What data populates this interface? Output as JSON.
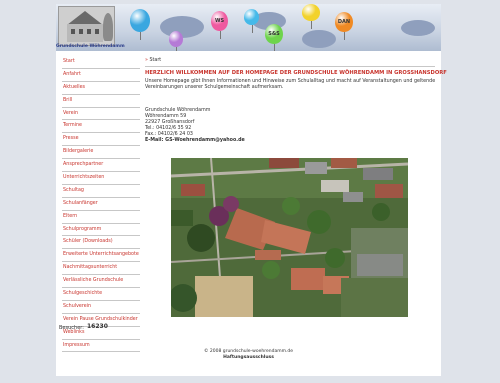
{
  "header": {
    "school_caption": "Grundschule Wöhrendamm",
    "balloons": [
      {
        "label": "",
        "color": "#3aa7e0"
      },
      {
        "label": "",
        "color": "#b57ad6"
      },
      {
        "label": "WS",
        "color": "#ef5aa0"
      },
      {
        "label": "",
        "color": "#45b9e9"
      },
      {
        "label": "S&S",
        "color": "#6ed44c"
      },
      {
        "label": "",
        "color": "#f2d22c"
      },
      {
        "label": "DAN",
        "color": "#f08a24"
      }
    ]
  },
  "nav": {
    "items": [
      {
        "label": "Start"
      },
      {
        "label": "Anfahrt"
      },
      {
        "label": "Aktuelles"
      },
      {
        "label": "Brill"
      },
      {
        "label": "Verein"
      },
      {
        "label": "Termine"
      },
      {
        "label": "Presse"
      },
      {
        "label": "Bildergalerie"
      },
      {
        "label": "Ansprechpartner"
      },
      {
        "label": "Unterrichtszeiten"
      },
      {
        "label": "Schultag"
      },
      {
        "label": "Schulanfänger"
      },
      {
        "label": "Eltern"
      },
      {
        "label": "Schulprogramm"
      },
      {
        "label": "Schüler (Downloads)"
      },
      {
        "label": "Erweiterte Unterrichtsangebote"
      },
      {
        "label": "Nachmittagsunterricht"
      },
      {
        "label": "Verlässliche Grundschule"
      },
      {
        "label": "Schulgeschichte"
      },
      {
        "label": "Schulverein"
      },
      {
        "label": "Verein Pause Grundschulkinder"
      },
      {
        "label": "Weblinks"
      },
      {
        "label": "Impressum"
      }
    ],
    "visitors_label": "Besucher:",
    "visitors_count": "16230"
  },
  "breadcrumb": {
    "separator": "»",
    "current": "Start"
  },
  "main": {
    "title": "HERZLICH WILLKOMMEN AUF DER HOMEPAGE DER GRUNDSCHULE WÖHRENDAMM IN GROSSHANSDORF",
    "intro": "Unsere Homepage gibt Ihnen Informationen und Hinweise zum Schulalltag und macht auf Veranstaltungen und geltende Vereinbarungen unserer Schulgemeinschaft aufmerksam.",
    "address": {
      "name": "Grundschule Wöhrendamm",
      "street": "Wöhrendamm 59",
      "city": "22927 Großhansdorf",
      "tel": "Tel.: 04102/6 35 92",
      "fax": "Fax.: 04102/6 24 03",
      "email": "E-Mail: GS-Woehrendamm@yahoo.de"
    }
  },
  "footer": {
    "copyright": "© 2008 grundschule-woehrendamm.de",
    "imprint": "Haftungsausschluss"
  }
}
